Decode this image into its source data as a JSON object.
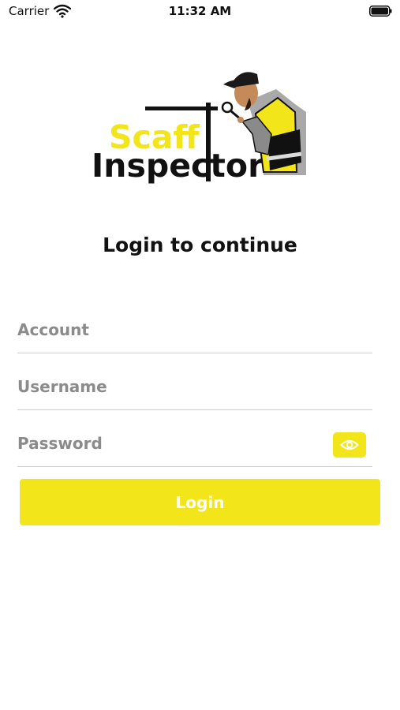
{
  "status_bar": {
    "carrier": "Carrier",
    "time": "11:32 AM"
  },
  "logo": {
    "word1": "Scaff",
    "word2": "Inspector",
    "accent_color": "#f2e519"
  },
  "heading": "Login to continue",
  "form": {
    "account": {
      "placeholder": "Account",
      "value": ""
    },
    "username": {
      "placeholder": "Username",
      "value": ""
    },
    "password": {
      "placeholder": "Password",
      "value": ""
    },
    "show_password_icon": "eye-icon",
    "login_label": "Login"
  },
  "colors": {
    "primary": "#f2e519",
    "divider": "#cfcfcf",
    "placeholder": "#8b8b8b"
  }
}
